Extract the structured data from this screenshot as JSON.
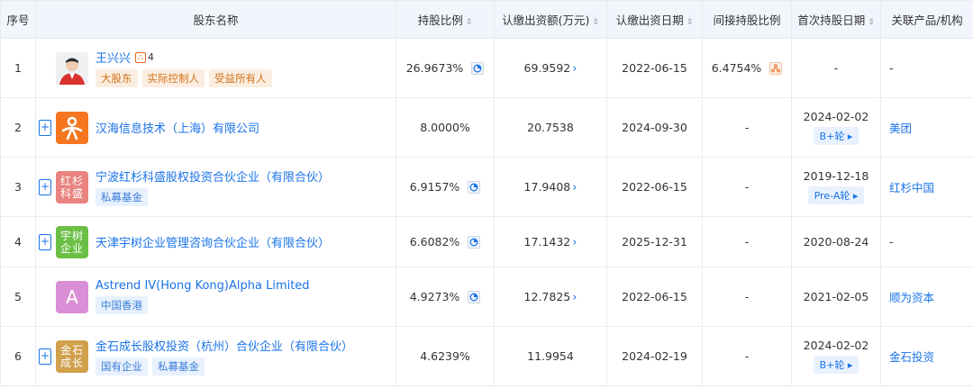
{
  "headers": {
    "idx": "序号",
    "name": "股东名称",
    "ratio": "持股比例",
    "amount": "认缴出资额(万元)",
    "date": "认缴出资日期",
    "indirect": "间接持股比例",
    "first_date": "首次持股日期",
    "related": "关联产品/机构",
    "sort_glyph": "⇕"
  },
  "icons": {
    "chevron": "›",
    "round_arrow": "▸",
    "plus": "+"
  },
  "rows": [
    {
      "idx": "1",
      "name": "王兴兴",
      "badge_count": "4",
      "tags": [
        "大股东",
        "实际控制人",
        "受益所有人"
      ],
      "ratio": "26.9673%",
      "amount": "69.9592",
      "date": "2022-06-15",
      "indirect": "6.4754%",
      "first_date": "-",
      "round": "",
      "related": "-"
    },
    {
      "idx": "2",
      "name": "汉海信息技术（上海）有限公司",
      "tags": [],
      "ratio": "8.0000%",
      "amount": "20.7538",
      "date": "2024-09-30",
      "indirect": "-",
      "first_date": "2024-02-02",
      "round": "B+轮",
      "related": "美团"
    },
    {
      "idx": "3",
      "name": "宁波红杉科盛股权投资合伙企业（有限合伙）",
      "logo_text": "红杉科盛",
      "tags": [
        "私募基金"
      ],
      "ratio": "6.9157%",
      "amount": "17.9408",
      "date": "2022-06-15",
      "indirect": "-",
      "first_date": "2019-12-18",
      "round": "Pre-A轮",
      "related": "红杉中国"
    },
    {
      "idx": "4",
      "name": "天津宇树企业管理咨询合伙企业（有限合伙）",
      "logo_text": "宇树企业",
      "tags": [],
      "ratio": "6.6082%",
      "amount": "17.1432",
      "date": "2025-12-31",
      "indirect": "-",
      "first_date": "2020-08-24",
      "round": "",
      "related": "-"
    },
    {
      "idx": "5",
      "name": "Astrend IV(Hong Kong)Alpha Limited",
      "logo_text": "A",
      "tags": [
        "中国香港"
      ],
      "ratio": "4.9273%",
      "amount": "12.7825",
      "date": "2022-06-15",
      "indirect": "-",
      "first_date": "2021-02-05",
      "round": "",
      "related": "顺为资本"
    },
    {
      "idx": "6",
      "name": "金石成长股权投资（杭州）合伙企业（有限合伙）",
      "logo_text": "金石成长",
      "tags": [
        "国有企业",
        "私募基金"
      ],
      "ratio": "4.6239%",
      "amount": "11.9954",
      "date": "2024-02-19",
      "indirect": "-",
      "first_date": "2024-02-02",
      "round": "B+轮",
      "related": "金石投资"
    }
  ],
  "colors": {
    "link": "#1a73e8",
    "header_bg": "#f2f6fc",
    "logo_meituan": "#f5761f",
    "logo_hongshan": "#e8837f",
    "logo_yushu": "#6bbf45",
    "logo_astrend": "#d98ed6",
    "logo_jinshi": "#d1a04d",
    "tag_orange": "#d2721b",
    "tag_blue": "#3b7ed8"
  }
}
